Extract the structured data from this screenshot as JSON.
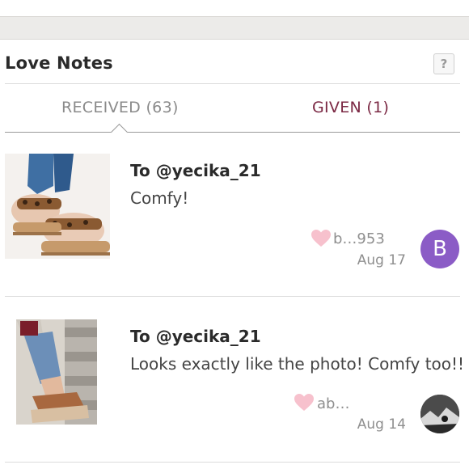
{
  "header": {
    "title": "Love Notes",
    "help_label": "?"
  },
  "tabs": {
    "received_label": "RECEIVED",
    "received_count": "(63)",
    "given_label": "GIVEN (1)"
  },
  "notes": [
    {
      "title": "To @yecika_21",
      "message": "Comfy!",
      "sender": "b…953",
      "date": "Aug 17",
      "avatar_letter": "B",
      "avatar_color": "#8b5cc6",
      "thumb_desc": "leopard-sandal-photo"
    },
    {
      "title": "To @yecika_21",
      "message": "Looks exactly like the photo! Comfy too!!",
      "sender": "ab…",
      "date": "Aug 14",
      "thumb_desc": "brown-sandal-photo"
    }
  ],
  "colors": {
    "accent": "#7b2944",
    "heart": "#f7c1cd",
    "avatar_purple": "#8b5cc6"
  }
}
